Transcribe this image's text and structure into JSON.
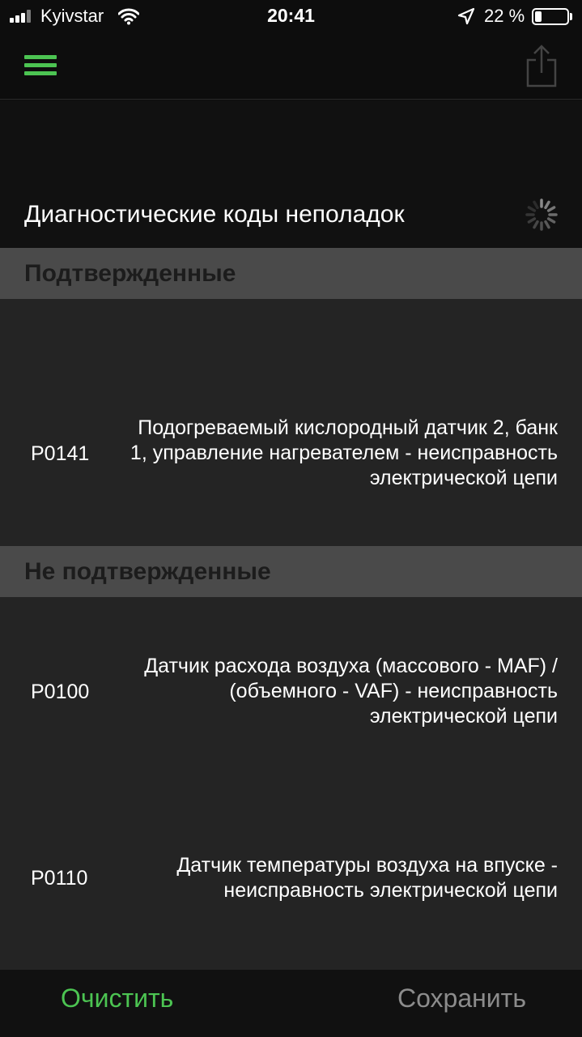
{
  "status_bar": {
    "carrier": "Kyivstar",
    "time": "20:41",
    "battery_percent": "22 %",
    "battery_level": 0.22,
    "icons": [
      "signal-icon",
      "wifi-icon",
      "location-arrow-icon",
      "battery-icon"
    ]
  },
  "nav": {
    "menu_icon": "hamburger-menu-icon",
    "share_icon": "share-icon"
  },
  "title": "Диагностические коды неполадок",
  "sections": [
    {
      "label": "Подтвержденные",
      "items": [
        {
          "code": "P0141",
          "description": "Подогреваемый кислородный датчик 2, банк 1, управление нагревателем - неисправность электрической цепи"
        }
      ]
    },
    {
      "label": "Не подтвержденные",
      "items": [
        {
          "code": "P0100",
          "description": "Датчик расхода воздуха (массового - MAF) / (объемного - VAF) - неисправность электрической цепи"
        },
        {
          "code": "P0110",
          "description": "Датчик температуры воздуха на впуске - неисправность электрической цепи"
        }
      ]
    }
  ],
  "toolbar": {
    "clear_label": "Очистить",
    "save_label": "Сохранить"
  },
  "colors": {
    "accent": "#4cc452",
    "background": "#0d0d0d",
    "row_background": "#242424",
    "section_header_background": "#4a4a4a",
    "disabled_text": "#8c8c8c"
  }
}
